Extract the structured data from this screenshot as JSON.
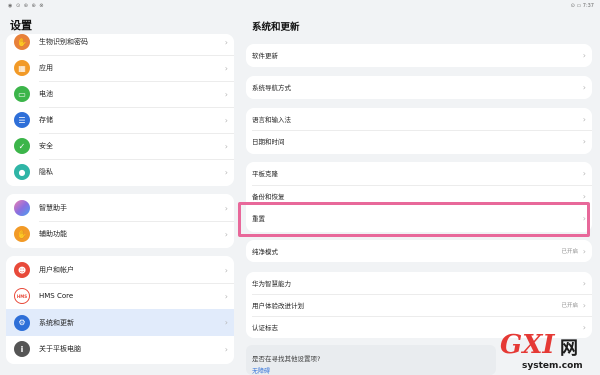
{
  "statusbar": {
    "left_icons": "◉ ⊙ ⊛ ⊕ ⊗",
    "right_text": "⊙ ▭ 7:37"
  },
  "left_pane": {
    "title": "设置",
    "groups": [
      {
        "items": [
          {
            "label": "生物识别和密码",
            "icon": "fingerprint-icon",
            "color": "#e8813a"
          },
          {
            "label": "应用",
            "icon": "apps-icon",
            "color": "#f29a27"
          },
          {
            "label": "电池",
            "icon": "battery-icon",
            "color": "#3cb54a"
          },
          {
            "label": "存储",
            "icon": "storage-icon",
            "color": "#2e6fd8"
          },
          {
            "label": "安全",
            "icon": "security-icon",
            "color": "#3cb54a"
          },
          {
            "label": "隐私",
            "icon": "privacy-icon",
            "color": "#2fb5a6"
          }
        ]
      },
      {
        "items": [
          {
            "label": "智慧助手",
            "icon": "assistant-icon",
            "color": "#8a6fe0"
          },
          {
            "label": "辅助功能",
            "icon": "accessibility-icon",
            "color": "#f29a27"
          }
        ]
      },
      {
        "items": [
          {
            "label": "用户和帐户",
            "icon": "user-icon",
            "color": "#e84a3a"
          },
          {
            "label": "HMS Core",
            "icon": "hms-core-icon",
            "color": "#e84a3a",
            "glyph": "HMS"
          },
          {
            "label": "系统和更新",
            "icon": "system-update-icon",
            "color": "#2e6fd8",
            "selected": true
          },
          {
            "label": "关于平板电脑",
            "icon": "info-icon",
            "color": "#555555"
          }
        ]
      }
    ]
  },
  "right_pane": {
    "title": "系统和更新",
    "groups": [
      {
        "items": [
          {
            "label": "软件更新"
          }
        ]
      },
      {
        "items": [
          {
            "label": "系统导航方式"
          }
        ]
      },
      {
        "items": [
          {
            "label": "语言和输入法"
          },
          {
            "label": "日期和时间"
          }
        ]
      },
      {
        "items": [
          {
            "label": "平板克隆"
          },
          {
            "label": "备份和恢复"
          },
          {
            "label": "重置"
          }
        ]
      },
      {
        "items": [
          {
            "label": "纯净模式",
            "status": "已开启"
          }
        ]
      },
      {
        "items": [
          {
            "label": "华为智慧能力"
          },
          {
            "label": "用户体验改进计划",
            "status": "已开启"
          },
          {
            "label": "认证标志"
          }
        ]
      }
    ],
    "more": {
      "question": "是否在寻找其他设置项?",
      "answer": "无障碍"
    }
  },
  "watermark": {
    "big": "GXI",
    "wang": "网",
    "small": "system.com"
  },
  "colors": {
    "background": "#f1f3f5",
    "selected": "#e1ebfb",
    "highlight": "#e8689a",
    "link": "#2e6fd8"
  }
}
